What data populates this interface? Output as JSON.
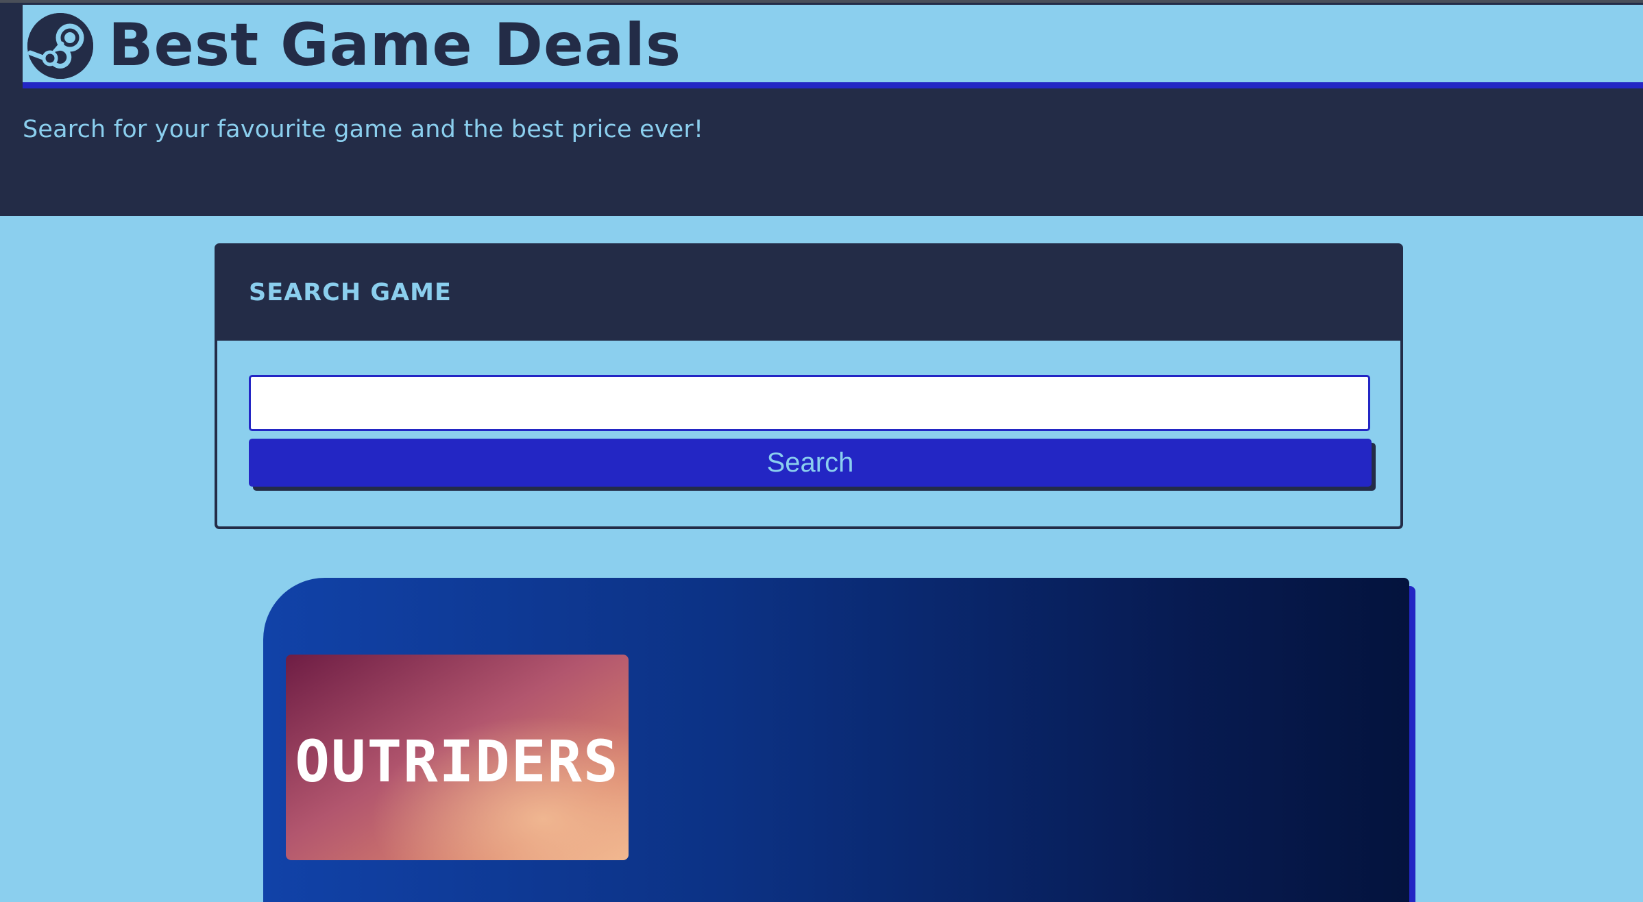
{
  "header": {
    "logo_icon": "steam-logo-icon",
    "title": "Best Game Deals",
    "tagline": "Search for your favourite game and the best price ever!"
  },
  "search": {
    "heading": "SEARCH GAME",
    "input_value": "",
    "button_label": "Search"
  },
  "results": [
    {
      "thumbnail_text": "OUTRIDERS"
    }
  ],
  "colors": {
    "navy": "#232c47",
    "sky": "#8bcfee",
    "accent_blue": "#2326c4",
    "card_gradient_start": "#1142a8",
    "card_gradient_end": "#04133d"
  }
}
